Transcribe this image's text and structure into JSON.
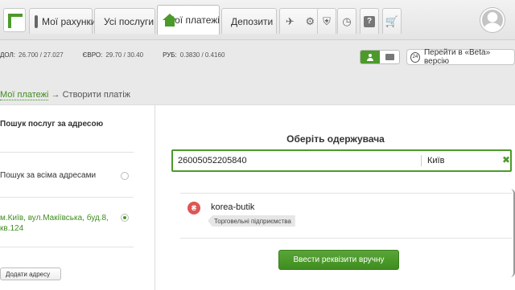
{
  "nav": {
    "tabs": [
      {
        "label": "Мої рахунки",
        "icon": "card-icon"
      },
      {
        "label": "Усі послуги",
        "icon": "list-icon"
      },
      {
        "label": "Мої платежі",
        "icon": "home-icon",
        "active": true
      },
      {
        "label": "Депозити",
        "icon": "piggy-bank-icon"
      }
    ],
    "icon_tabs": [
      "transport-icon",
      "media-icon",
      "emblem-icon",
      "clock-icon",
      "help-icon",
      "cart-icon"
    ]
  },
  "rates": [
    {
      "label": "ДОЛ:",
      "value": "26.700 / 27.027"
    },
    {
      "label": "ЄВРО:",
      "value": "29.70 / 30.40"
    },
    {
      "label": "РУБ:",
      "value": "0.3830 / 0.4160"
    }
  ],
  "beta": {
    "badge": "24",
    "label": "Перейти в «Beta» версію"
  },
  "breadcrumb": {
    "link": "Мої платежі",
    "arrow": "→",
    "current": "Створити платіж"
  },
  "sidebar": {
    "title": "Пошук послуг за адресою",
    "all_addresses": "Пошук за всіма адресами",
    "address_line1": "м.Київ, вул.Макіївська, буд.8,",
    "address_line2": "кв.124",
    "add_button": "Додати адресу"
  },
  "main": {
    "title": "Оберіть одержувача",
    "search_value": "26005052205840",
    "city_value": "Київ",
    "clear": "✖",
    "result": {
      "coin": "₴",
      "name": "korea-butik",
      "tag": "Торговельні підприємства"
    },
    "manual_button": "Ввести реквізити вручну"
  },
  "colors": {
    "accent": "#4c9a2a",
    "coin": "#e05555"
  }
}
